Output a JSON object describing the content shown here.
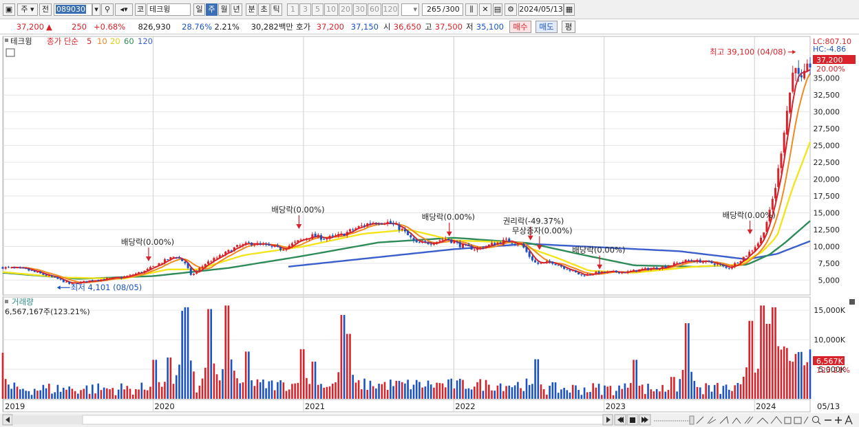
{
  "toolbar": {
    "market": "주",
    "prev_label": "전",
    "code": "089030",
    "class": "코",
    "name": "테크윙",
    "periods": [
      "일",
      "주",
      "월",
      "년",
      "분",
      "초",
      "틱"
    ],
    "selected_period": "주",
    "multipliers": [
      "1",
      "3",
      "5",
      "10",
      "20",
      "30",
      "60",
      "120"
    ],
    "count_value": "265",
    "count_max": "/300",
    "date": "2024/05/13"
  },
  "quote": {
    "price": "37,200",
    "change_arrow": "▲",
    "change": "250",
    "change_pct": "+0.68%",
    "volume": "826,930",
    "turnover_rate": "28.76%",
    "pct2": "2.21%",
    "amount": "30,282백만",
    "bid_label": "호가",
    "ask": "37,200",
    "bid": "37,150",
    "open_label": "시",
    "open": "36,650",
    "high_label": "고",
    "high": "37,500",
    "low_label": "저",
    "low": "35,100",
    "buy_label": "매수",
    "sell_label": "매도",
    "eval_label": "평"
  },
  "colors": {
    "up": "#d8232a",
    "down": "#1a52c4",
    "ma5": "#d8232a",
    "ma10": "#f08a1c",
    "ma20": "#f2e51e",
    "ma60": "#2e8b57",
    "ma120": "#3a5fcd",
    "grid": "#e6e6e6"
  },
  "chart_data": [
    {
      "type": "candlestick",
      "panel": "price",
      "name_label": "테크윙",
      "ma_label": "종가 단순",
      "ma_periods": [
        "5",
        "10",
        "20",
        "60",
        "120"
      ],
      "ylim": [
        3000,
        41000
      ],
      "yticks": [
        5000,
        7500,
        10000,
        12500,
        15000,
        17500,
        20000,
        22500,
        25000,
        27500,
        30000,
        32500,
        35000
      ],
      "ytick_labels": [
        "5,000",
        "7,500",
        "10,000",
        "12,500",
        "15,000",
        "17,500",
        "20,000",
        "22,500",
        "25,000",
        "27,500",
        "30,000",
        "32,500",
        "35,000"
      ],
      "x_labels": [
        "2019",
        "2020",
        "2021",
        "2022",
        "2023",
        "2024",
        "05/13"
      ],
      "x_years": [
        2019,
        2020,
        2021,
        2022,
        2023,
        2024
      ],
      "x_start": 2019.0,
      "x_end": 2024.37,
      "ref_lc": "LC:807.10",
      "ref_hc": "HC:-4.86",
      "current_price_label": "37,200",
      "current_pct_label": "20.00%",
      "close_keypoints": [
        [
          2019.0,
          6900
        ],
        [
          2019.15,
          6600
        ],
        [
          2019.35,
          5300
        ],
        [
          2019.45,
          4400
        ],
        [
          2019.6,
          5000
        ],
        [
          2019.8,
          5400
        ],
        [
          2019.95,
          6400
        ],
        [
          2020.05,
          7600
        ],
        [
          2020.15,
          8600
        ],
        [
          2020.22,
          7400
        ],
        [
          2020.25,
          5600
        ],
        [
          2020.35,
          7500
        ],
        [
          2020.45,
          8600
        ],
        [
          2020.55,
          9900
        ],
        [
          2020.65,
          10500
        ],
        [
          2020.75,
          10100
        ],
        [
          2020.85,
          9600
        ],
        [
          2020.95,
          10600
        ],
        [
          2021.05,
          11600
        ],
        [
          2021.15,
          11200
        ],
        [
          2021.25,
          11700
        ],
        [
          2021.35,
          12700
        ],
        [
          2021.45,
          13600
        ],
        [
          2021.55,
          13700
        ],
        [
          2021.65,
          12600
        ],
        [
          2021.75,
          10400
        ],
        [
          2021.85,
          10600
        ],
        [
          2021.95,
          11200
        ],
        [
          2022.05,
          10100
        ],
        [
          2022.15,
          9600
        ],
        [
          2022.25,
          10300
        ],
        [
          2022.35,
          10900
        ],
        [
          2022.45,
          10300
        ],
        [
          2022.5,
          8600
        ],
        [
          2022.55,
          7400
        ],
        [
          2022.65,
          7700
        ],
        [
          2022.75,
          6700
        ],
        [
          2022.85,
          5700
        ],
        [
          2022.95,
          6100
        ],
        [
          2023.05,
          6200
        ],
        [
          2023.15,
          6200
        ],
        [
          2023.25,
          6600
        ],
        [
          2023.35,
          6800
        ],
        [
          2023.45,
          7300
        ],
        [
          2023.55,
          7900
        ],
        [
          2023.65,
          7800
        ],
        [
          2023.75,
          7400
        ],
        [
          2023.82,
          6700
        ],
        [
          2023.9,
          7900
        ],
        [
          2023.98,
          9400
        ],
        [
          2024.04,
          11000
        ],
        [
          2024.1,
          15000
        ],
        [
          2024.15,
          20000
        ],
        [
          2024.2,
          28000
        ],
        [
          2024.25,
          35000
        ],
        [
          2024.27,
          38000
        ],
        [
          2024.3,
          34000
        ],
        [
          2024.33,
          35000
        ],
        [
          2024.37,
          37200
        ]
      ],
      "ma120_keypoints": [
        [
          2020.9,
          7000
        ],
        [
          2022.0,
          9600
        ],
        [
          2022.5,
          10400
        ],
        [
          2023.5,
          9300
        ],
        [
          2023.95,
          8100
        ],
        [
          2024.15,
          8900
        ],
        [
          2024.37,
          10800
        ]
      ],
      "ma60_keypoints": [
        [
          2019.0,
          6100
        ],
        [
          2019.5,
          5200
        ],
        [
          2020.0,
          5600
        ],
        [
          2020.5,
          6800
        ],
        [
          2021.0,
          8600
        ],
        [
          2021.5,
          10600
        ],
        [
          2022.0,
          11300
        ],
        [
          2022.5,
          10500
        ],
        [
          2022.85,
          8800
        ],
        [
          2023.2,
          7200
        ],
        [
          2023.6,
          7000
        ],
        [
          2023.95,
          7300
        ],
        [
          2024.1,
          8800
        ],
        [
          2024.2,
          10500
        ],
        [
          2024.37,
          13800
        ]
      ],
      "ma20_keypoints": [
        [
          2019.0,
          6200
        ],
        [
          2019.4,
          5400
        ],
        [
          2019.8,
          5200
        ],
        [
          2020.1,
          6600
        ],
        [
          2020.3,
          6600
        ],
        [
          2020.6,
          8700
        ],
        [
          2021.0,
          10000
        ],
        [
          2021.4,
          11900
        ],
        [
          2021.7,
          12500
        ],
        [
          2022.0,
          10900
        ],
        [
          2022.4,
          10600
        ],
        [
          2022.7,
          8200
        ],
        [
          2022.9,
          6400
        ],
        [
          2023.2,
          6100
        ],
        [
          2023.6,
          7000
        ],
        [
          2023.9,
          7300
        ],
        [
          2024.05,
          9200
        ],
        [
          2024.15,
          11500
        ],
        [
          2024.25,
          18500
        ],
        [
          2024.37,
          25500
        ]
      ],
      "annotations": [
        {
          "text": "배당락(0.00%)",
          "x": 2019.97,
          "y": 7600,
          "arrow": true
        },
        {
          "text": "배당락(0.00%)",
          "x": 2020.97,
          "y": 12400,
          "arrow": true
        },
        {
          "text": "배당락(0.00%)",
          "x": 2021.97,
          "y": 11300,
          "arrow": true
        },
        {
          "text": "권리락(-49.37%)",
          "x": 2022.51,
          "y": 10700,
          "arrow": true
        },
        {
          "text": "무상증자(0.00%)",
          "x": 2022.57,
          "y": 9300,
          "arrow": true
        },
        {
          "text": "배당락(0.00%)",
          "x": 2022.97,
          "y": 6400,
          "arrow": true
        },
        {
          "text": "배당락(0.00%)",
          "x": 2023.97,
          "y": 11600,
          "arrow": true
        },
        {
          "text": "최고 39,100 (04/08)",
          "x": 2024.27,
          "y": 39100,
          "arrow": false
        },
        {
          "text": "최저 4,101 (08/05)",
          "x": 2019.42,
          "y": 4101,
          "arrow": false
        }
      ]
    },
    {
      "type": "bar",
      "panel": "volume",
      "title": "거래량",
      "latest": "6,567,167주(123.21%)",
      "latest_value_label": "6,567K",
      "latest_pct_label": "123.21%",
      "ylim": [
        0,
        17000000
      ],
      "yticks": [
        5000000,
        10000000,
        15000000
      ],
      "ytick_labels": [
        "5,000K",
        "10,000K",
        "15,000K"
      ],
      "spikes": [
        [
          2019.0,
          7800000
        ],
        [
          2020.02,
          6600000
        ],
        [
          2020.1,
          7000000
        ],
        [
          2020.2,
          14900000
        ],
        [
          2020.23,
          15500000
        ],
        [
          2020.38,
          15200000
        ],
        [
          2020.5,
          15800000
        ],
        [
          2020.63,
          8000000
        ],
        [
          2021.0,
          8400000
        ],
        [
          2021.07,
          6300000
        ],
        [
          2021.27,
          14200000
        ],
        [
          2021.3,
          11000000
        ],
        [
          2022.55,
          6700000
        ],
        [
          2023.2,
          6600000
        ],
        [
          2023.45,
          3700000
        ],
        [
          2023.55,
          12800000
        ],
        [
          2023.97,
          13200000
        ],
        [
          2024.06,
          15800000
        ],
        [
          2024.1,
          12700000
        ],
        [
          2024.13,
          15500000
        ],
        [
          2024.2,
          8600000
        ],
        [
          2024.28,
          7600000
        ],
        [
          2024.37,
          6570000
        ]
      ]
    }
  ]
}
